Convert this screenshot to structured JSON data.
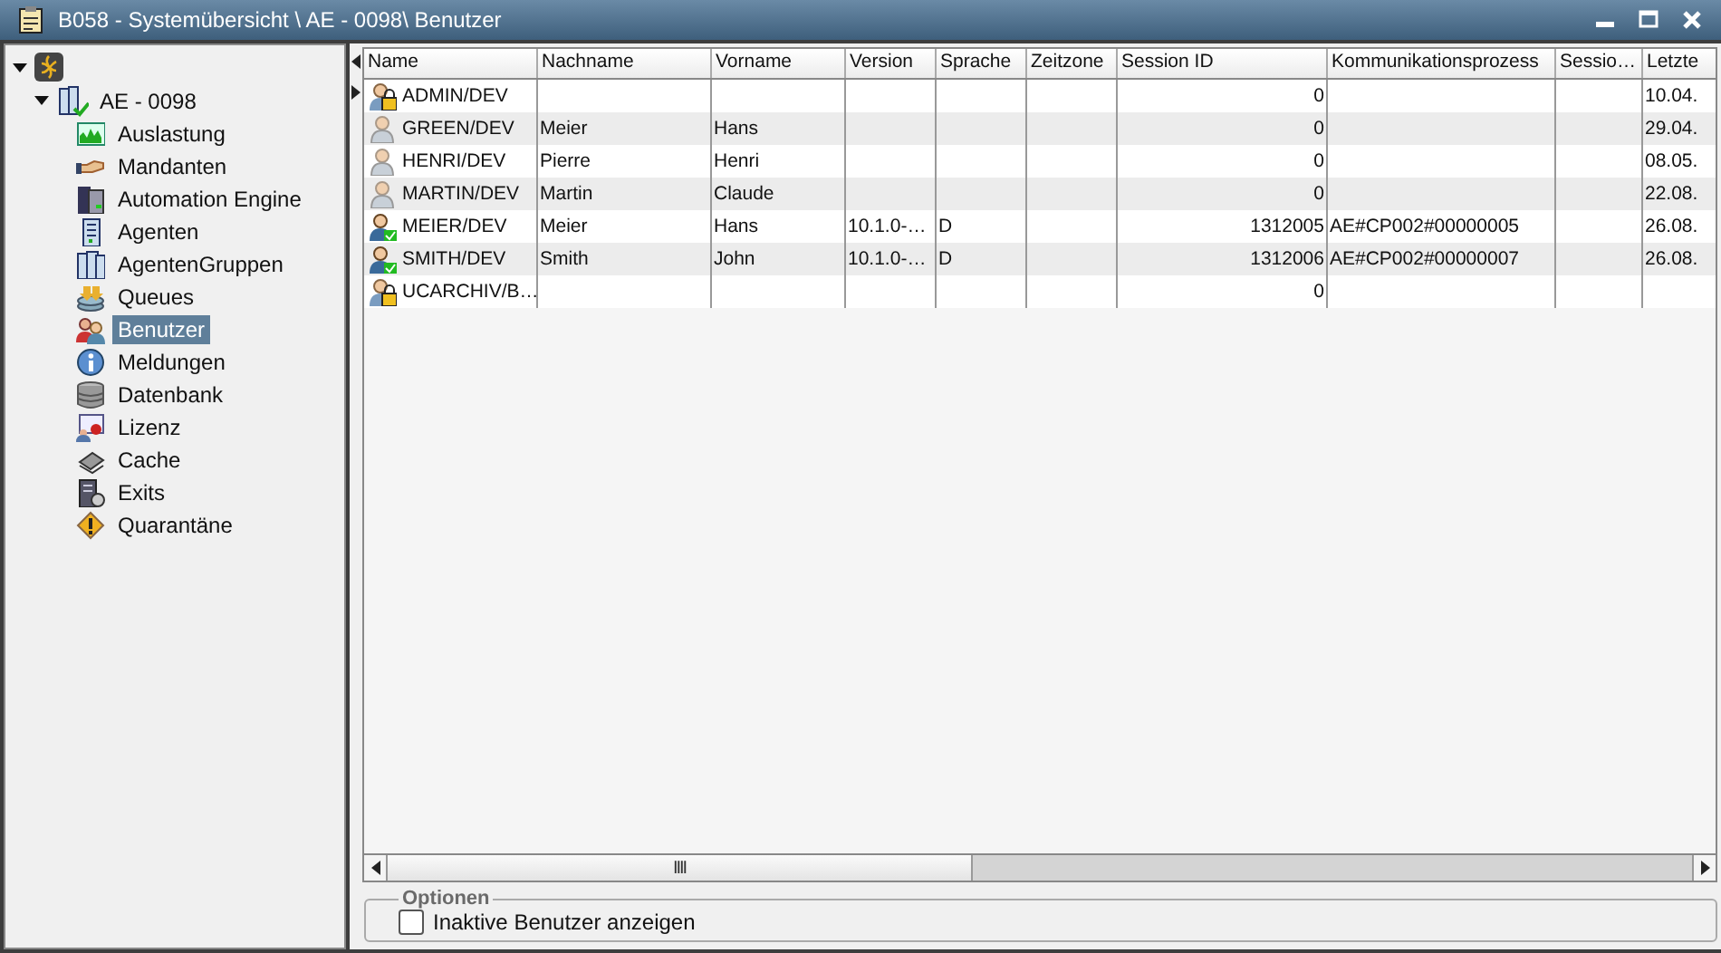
{
  "window": {
    "title": "B058 - Systemübersicht \\ AE - 0098\\ Benutzer"
  },
  "tree": {
    "expanded": true,
    "children": [
      {
        "label": "AE - 0098",
        "expanded": true,
        "children": [
          {
            "label": "Auslastung",
            "selected": false
          },
          {
            "label": "Mandanten",
            "selected": false
          },
          {
            "label": "Automation Engine",
            "selected": false
          },
          {
            "label": "Agenten",
            "selected": false
          },
          {
            "label": "AgentenGruppen",
            "selected": false
          },
          {
            "label": "Queues",
            "selected": false
          },
          {
            "label": "Benutzer",
            "selected": true
          },
          {
            "label": "Meldungen",
            "selected": false
          },
          {
            "label": "Datenbank",
            "selected": false
          },
          {
            "label": "Lizenz",
            "selected": false
          },
          {
            "label": "Cache",
            "selected": false
          },
          {
            "label": "Exits",
            "selected": false
          },
          {
            "label": "Quarantäne",
            "selected": false
          }
        ]
      }
    ]
  },
  "table": {
    "columns": [
      "Name",
      "Nachname",
      "Vorname",
      "Version",
      "Sprache",
      "Zeitzone",
      "Session ID",
      "Kommunikationsprozess",
      "Sessio…",
      "Letzte"
    ],
    "rows": [
      {
        "kind": "locked",
        "current": true,
        "cells": [
          "ADMIN/DEV",
          "",
          "",
          "",
          "",
          "",
          "0",
          "",
          "",
          "10.04."
        ]
      },
      {
        "kind": "plain",
        "current": false,
        "cells": [
          "GREEN/DEV",
          "Meier",
          "Hans",
          "",
          "",
          "",
          "0",
          "",
          "",
          "29.04."
        ]
      },
      {
        "kind": "plain",
        "current": false,
        "cells": [
          "HENRI/DEV",
          "Pierre",
          "Henri",
          "",
          "",
          "",
          "0",
          "",
          "",
          "08.05."
        ]
      },
      {
        "kind": "plain",
        "current": false,
        "cells": [
          "MARTIN/DEV",
          "Martin",
          "Claude",
          "",
          "",
          "",
          "0",
          "",
          "",
          "22.08."
        ]
      },
      {
        "kind": "active",
        "current": false,
        "cells": [
          "MEIER/DEV",
          "Meier",
          "Hans",
          "10.1.0-…",
          "D",
          "",
          "1312005",
          "AE#CP002#00000005",
          "",
          "26.08."
        ]
      },
      {
        "kind": "active",
        "current": false,
        "cells": [
          "SMITH/DEV",
          "Smith",
          "John",
          "10.1.0-…",
          "D",
          "",
          "1312006",
          "AE#CP002#00000007",
          "",
          "26.08."
        ]
      },
      {
        "kind": "locked",
        "current": false,
        "cells": [
          "UCARCHIV/B…",
          "",
          "",
          "",
          "",
          "",
          "0",
          "",
          "",
          ""
        ]
      }
    ]
  },
  "scrollbar": {
    "grip": "IIII"
  },
  "options": {
    "title": "Optionen",
    "checkbox": {
      "label": "Inaktive Benutzer anzeigen",
      "checked": false
    }
  }
}
